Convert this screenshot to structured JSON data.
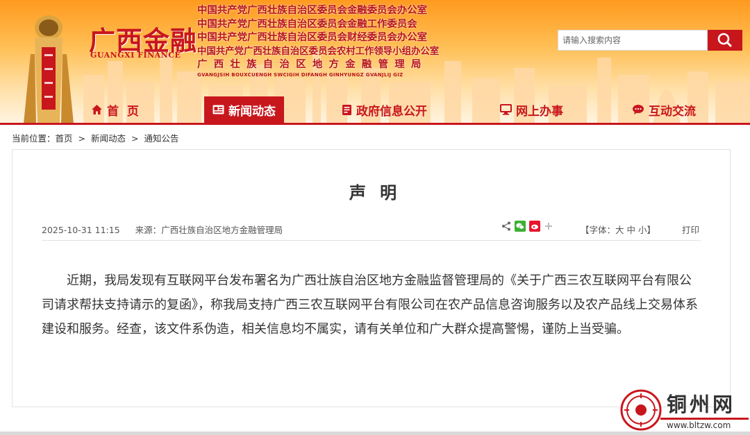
{
  "site": {
    "logo_title": "广西金融",
    "logo_subtitle": "GUANGXI FINANCE",
    "orgs": [
      "中国共产党广西壮族自治区委员会金融委员会办公室",
      "中国共产党广西壮族自治区委员会金融工作委员会",
      "中国共产党广西壮族自治区委员会财经委员会办公室",
      "中国共产党广西壮族自治区委员会农村工作领导小组办公室",
      "广西壮族自治区地方金融管理局"
    ],
    "org_zhuang": "GVANGJSIH BOUXCUENGH SWCIGIH DIFANGH GINHYUNGZ GVANJLIJ GIZ"
  },
  "search": {
    "placeholder": "请输入搜索内容"
  },
  "nav": [
    {
      "label": "首  页",
      "icon": "home-icon"
    },
    {
      "label": "新闻动态",
      "icon": "newspaper-icon",
      "active": true
    },
    {
      "label": "政府信息公开",
      "icon": "document-icon"
    },
    {
      "label": "网上办事",
      "icon": "monitor-icon"
    },
    {
      "label": "互动交流",
      "icon": "chat-icon"
    }
  ],
  "breadcrumb": {
    "prefix": "当前位置：",
    "items": [
      "首页",
      "新闻动态",
      "通知公告"
    ],
    "sep": ">"
  },
  "article": {
    "title": "声 明",
    "date": "2025-10-31 11:15",
    "source": "来源：广西壮族自治区地方金融管理局",
    "font_label": "【字体：",
    "font_sizes": [
      "大",
      "中",
      "小"
    ],
    "font_close": "】",
    "print": "打印",
    "body": "近期，我局发现有互联网平台发布署名为广西壮族自治区地方金融监督管理局的《关于广西三农互联网平台有限公司请求帮扶支持请示的复函》，称我局支持广西三农互联网平台有限公司在农产品信息咨询服务以及农产品线上交易体系建设和服务。经查，该文件系伪造，相关信息均不属实，请有关单位和广大群众提高警惕，谨防上当受骗。"
  },
  "share_icons": [
    "share-icon",
    "wechat-icon",
    "weibo-icon",
    "plus-icon"
  ],
  "watermark": {
    "name": "铜州网",
    "url": "www.bltzw.com"
  },
  "colors": {
    "brand_red": "#c8161d",
    "header_orange": "#ff9a1f"
  }
}
